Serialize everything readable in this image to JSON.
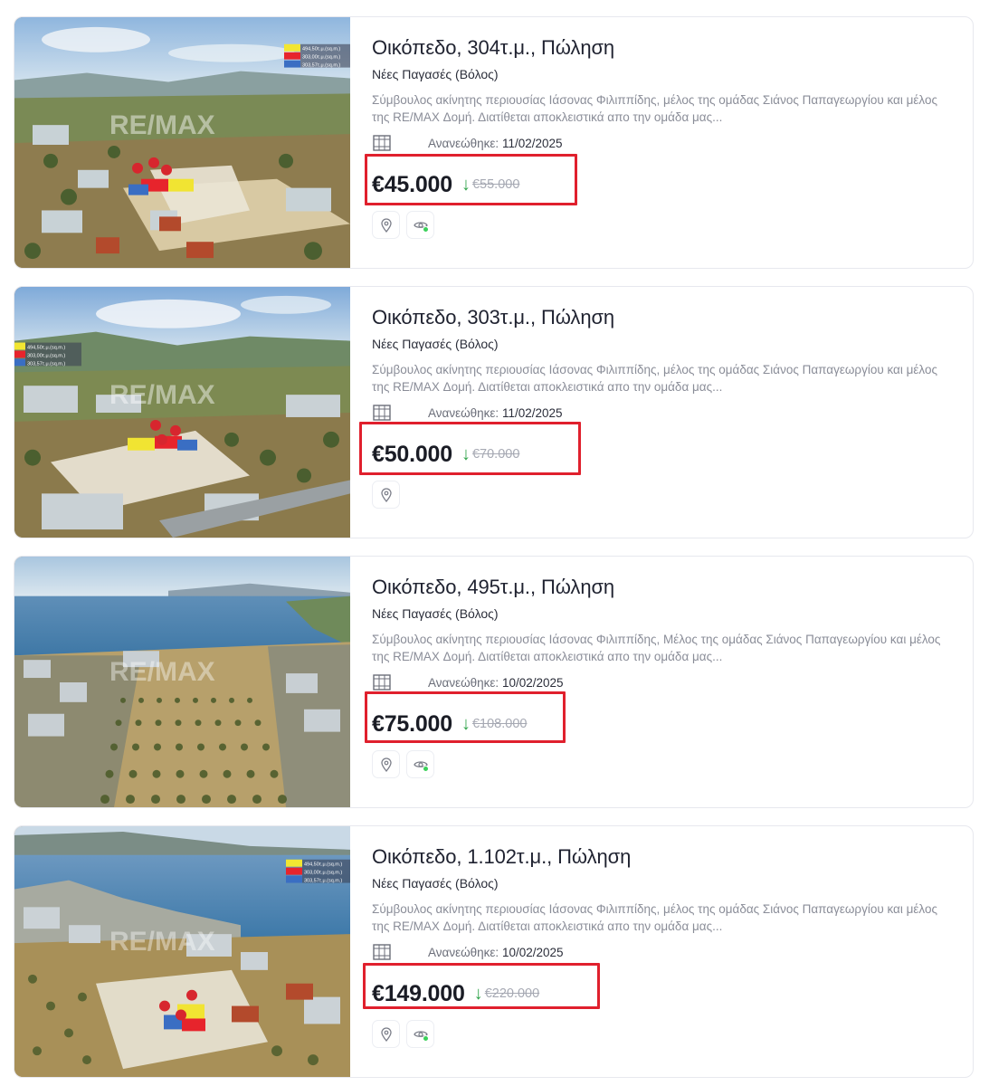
{
  "listings": [
    {
      "title": "Οικόπεδο, 304τ.μ., Πώληση",
      "location": "Νέες Παγασές (Βόλος)",
      "description": "Σύμβουλος ακίνητης περιουσίας Ιάσονας Φιλιππίδης, μέλος της ομάδας Σιάνος Παπαγεωργίου και μέλος της RE/MAX Δομή. Διατίθεται αποκλειστικά απο την ομάδα μας...",
      "updated_label": "Ανανεώθηκε:",
      "updated_date": "11/02/2025",
      "price": "€45.000",
      "old_price": "€55.000",
      "has_view_button": true,
      "watermark": "RE/MAX",
      "legend": [
        "494,50τ.μ.(sq.m.)",
        "303,00τ.μ.(sq.m.)",
        "303,57τ.μ.(sq.m.)"
      ]
    },
    {
      "title": "Οικόπεδο, 303τ.μ., Πώληση",
      "location": "Νέες Παγασές (Βόλος)",
      "description": "Σύμβουλος ακίνητης περιουσίας Ιάσονας Φιλιππίδης, μέλος της ομάδας Σιάνος Παπαγεωργίου και μέλος της RE/MAX Δομή. Διατίθεται αποκλειστικά απο την ομάδα μας...",
      "updated_label": "Ανανεώθηκε:",
      "updated_date": "11/02/2025",
      "price": "€50.000",
      "old_price": "€70.000",
      "has_view_button": false,
      "watermark": "RE/MAX",
      "legend": [
        "494,50τ.μ.(sq.m.)",
        "303,00τ.μ.(sq.m.)",
        "303,57τ.μ.(sq.m.)"
      ]
    },
    {
      "title": "Οικόπεδο, 495τ.μ., Πώληση",
      "location": "Νέες Παγασές (Βόλος)",
      "description": "Σύμβουλος ακίνητης περιουσίας Ιάσονας Φιλιππίδης, Μέλος της ομάδας Σιάνος Παπαγεωργίου και μέλος της RE/MAX Δομή. Διατίθεται αποκλειστικά απο την ομάδα μας...",
      "updated_label": "Ανανεώθηκε:",
      "updated_date": "10/02/2025",
      "price": "€75.000",
      "old_price": "€108.000",
      "has_view_button": true,
      "watermark": "RE/MAX",
      "legend": []
    },
    {
      "title": "Οικόπεδο, 1.102τ.μ., Πώληση",
      "location": "Νέες Παγασές (Βόλος)",
      "description": "Σύμβουλος ακίνητης περιουσίας Ιάσονας Φιλιππίδης, μέλος της ομάδας Σιάνος Παπαγεωργίου και μέλος της RE/MAX Δομή. Διατίθεται αποκλειστικά απο την ομάδα μας...",
      "updated_label": "Ανανεώθηκε:",
      "updated_date": "10/02/2025",
      "price": "€149.000",
      "old_price": "€220.000",
      "has_view_button": true,
      "watermark": "RE/MAX",
      "legend": [
        "494,50τ.μ.(sq.m.)",
        "303,00τ.μ.(sq.m.)",
        "303,57τ.μ.(sq.m.)"
      ]
    }
  ],
  "icons": {
    "plan": "floor-plan-icon",
    "map": "map-pin-icon",
    "view": "virtual-tour-eye-icon"
  },
  "colors": {
    "price_drop_arrow": "#2fa44a",
    "highlight_box": "#e0202d",
    "old_price": "#a6a9b3",
    "online_dot": "#3bd15a"
  }
}
